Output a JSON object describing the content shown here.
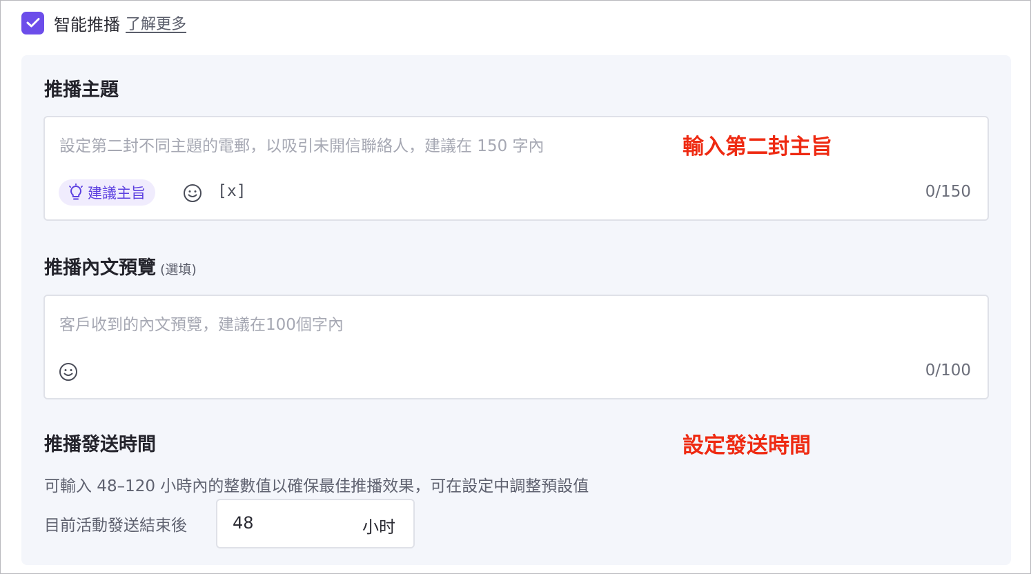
{
  "header": {
    "checkbox_checked": true,
    "label": "智能推播",
    "learn_more": "了解更多"
  },
  "subject": {
    "title": "推播主題",
    "placeholder": "設定第二封不同主題的電郵，以吸引未開信聯絡人，建議在 150 字內",
    "annotation": "輸入第二封主旨",
    "suggest_label": "建議主旨",
    "variable_label": "[x]",
    "counter": "0/150"
  },
  "preview": {
    "title": "推播內文預覽",
    "optional": "(選填)",
    "placeholder": "客戶收到的內文預覽，建議在100個字內",
    "counter": "0/100"
  },
  "send_time": {
    "title": "推播發送時間",
    "annotation": "設定發送時間",
    "help": "可輸入 48–120 小時內的整數值以確保最佳推播效果，可在設定中調整預設值",
    "after_label": "目前活動發送結束後",
    "hours_value": "48",
    "hours_unit": "小时"
  },
  "icons": {
    "checkbox": "check-icon",
    "suggest": "lightbulb-icon",
    "emoji": "smile-icon"
  },
  "colors": {
    "accent": "#6c4dea",
    "annotation": "#ee2a12",
    "panel_bg": "#f4f6fb"
  }
}
